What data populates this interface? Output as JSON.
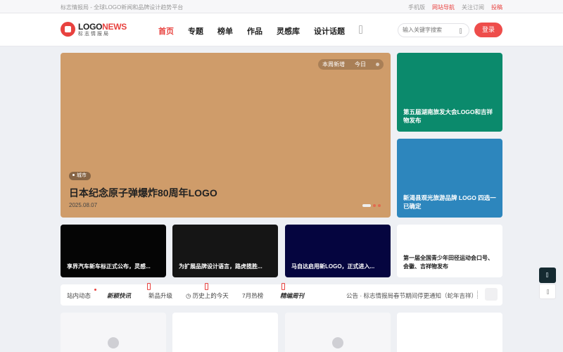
{
  "topbar": {
    "tagline": "标志情报局 - 全球LOGO新闻和品牌设计趋势平台",
    "links": [
      "手机版",
      "网站导航",
      "关注订阅",
      "投稿"
    ]
  },
  "logo": {
    "brand_a": "LOGO",
    "brand_b": "NEWS",
    "sub": "标志情报局"
  },
  "nav": [
    "首页",
    "专题",
    "榜单",
    "作品",
    "灵感库",
    "设计话题"
  ],
  "search": {
    "placeholder": "输入关键字搜索"
  },
  "login_label": "登录",
  "hero": {
    "tabs": [
      "本周新增",
      "今日"
    ],
    "badge": "城市",
    "title": "日本纪念原子弹爆炸80周年LOGO",
    "date": "2025.08.07"
  },
  "side_cards": [
    {
      "title": "第五届湖南旅发大会LOGO和吉祥物发布",
      "color": "#0b8a6c"
    },
    {
      "title": "新渴县观光旅游品牌 LOGO 四选一已确定",
      "color": "#2d86bd"
    }
  ],
  "row_cards": [
    {
      "title": "享界汽车新车标正式公布，灵感...",
      "color": "#050505"
    },
    {
      "title": "为扩展品牌设计语言，路虎揽胜...",
      "color": "#151515"
    },
    {
      "title": "马自达启用新LOGO，正式进入...",
      "color": "#05053f"
    },
    {
      "title": "第一届全国青少年田径运动会口号、会徽、吉祥物发布",
      "color": "#ffffff"
    }
  ],
  "ticker": {
    "items": [
      "站内动态",
      "新颖快讯",
      "新品升级",
      "历史上的今天",
      "7月热榜",
      "精编周刊"
    ],
    "notice": "公告 · 标志情报局春节期间停更通知（蛇年吉祥）"
  },
  "colors": {
    "accent": "#e8423f",
    "hero_bg": "#cf9c6a"
  }
}
